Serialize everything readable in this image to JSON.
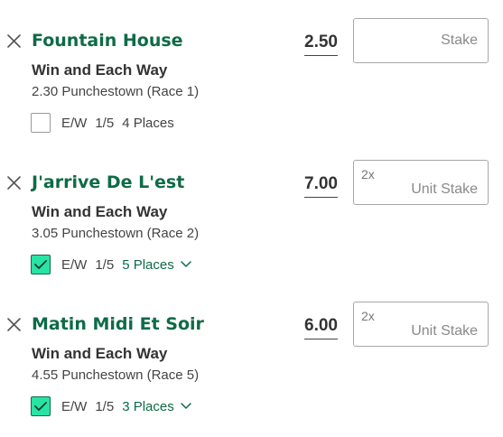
{
  "bets": [
    {
      "selection": "Fountain House",
      "market": "Win and Each Way",
      "event": "2.30 Punchestown (Race 1)",
      "odds": "2.50",
      "stake_multiplier": "",
      "stake_placeholder": "Stake",
      "ew_label": "E/W",
      "ew_terms": "1/5",
      "ew_checked": false,
      "places": "4 Places"
    },
    {
      "selection": "J'arrive De L'est",
      "market": "Win and Each Way",
      "event": "3.05 Punchestown (Race 2)",
      "odds": "7.00",
      "stake_multiplier": "2x",
      "stake_placeholder": "Unit Stake",
      "ew_label": "E/W",
      "ew_terms": "1/5",
      "ew_checked": true,
      "places": "5 Places"
    },
    {
      "selection": "Matin Midi Et Soir",
      "market": "Win and Each Way",
      "event": "4.55 Punchestown (Race 5)",
      "odds": "6.00",
      "stake_multiplier": "2x",
      "stake_placeholder": "Unit Stake",
      "ew_label": "E/W",
      "ew_terms": "1/5",
      "ew_checked": true,
      "places": "3 Places"
    }
  ],
  "icons": {
    "remove": "close-icon",
    "check": "checkmark-icon",
    "dropdown": "chevron-down-icon"
  },
  "colors": {
    "selection_text": "#0e6b47",
    "checkbox_checked_fill": "#27e3a4",
    "checkbox_checked_border": "#0e6b47",
    "places_dropdown_text": "#0e6b47"
  }
}
